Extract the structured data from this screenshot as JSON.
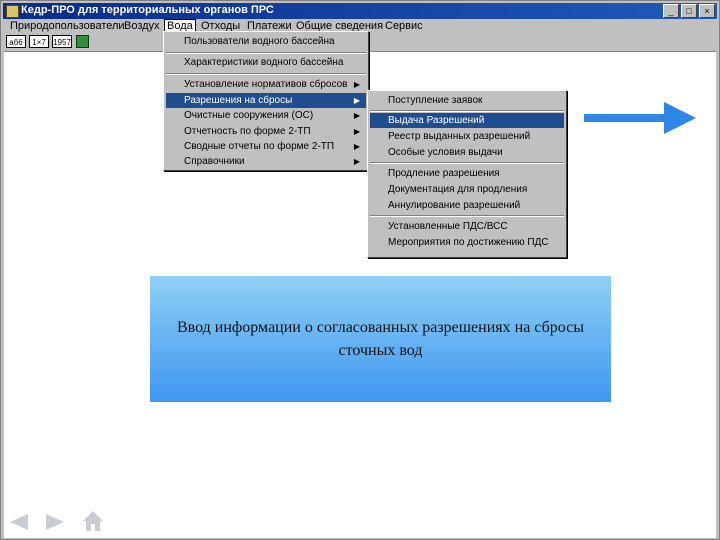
{
  "window": {
    "title": "Кедр-ПРО для территориальных органов ПРС",
    "buttons": [
      "_",
      "□",
      "×"
    ]
  },
  "menubar": {
    "items": [
      "Природопользователи",
      "Воздух",
      "Вода",
      "Отходы",
      "Платежи",
      "Общие сведения",
      "Сервис"
    ],
    "active_index": 2
  },
  "toolbar": {
    "buttons": [
      "аб6",
      "1×7",
      "1957",
      ""
    ]
  },
  "voda_menu": {
    "items": [
      {
        "label": "Пользователи водного бассейна",
        "submenu": false
      },
      {
        "label": "Характеристики водного бассейна",
        "submenu": false
      },
      {
        "label": "Установление нормативов сбросов",
        "submenu": true
      },
      {
        "label": "Разрешения на сбросы",
        "submenu": true,
        "highlighted": true
      },
      {
        "label": "Очистные сооружения (ОС)",
        "submenu": true
      },
      {
        "label": "Отчетность по форме 2-ТП",
        "submenu": true
      },
      {
        "label": "Сводные отчеты по форме 2-ТП",
        "submenu": true
      },
      {
        "label": "Справочники",
        "submenu": true
      }
    ]
  },
  "permits_menu": {
    "items": [
      {
        "label": "Поступление заявок"
      },
      {
        "label": "Выдача Разрешений",
        "highlighted": true
      },
      {
        "label": "Реестр выданных разрешений"
      },
      {
        "label": "Особые условия выдачи"
      },
      {
        "label": "Продление разрешения"
      },
      {
        "label": "Документация для продления"
      },
      {
        "label": "Аннулирование разрешений"
      },
      {
        "label": "Установленные ПДС/ВСС"
      },
      {
        "label": "Мероприятия по достижению ПДС"
      }
    ]
  },
  "callout": {
    "text": "Ввод информации о согласованных разрешениях на сбросы сточных вод"
  },
  "colors": {
    "titlebar": "#0a2a8a",
    "highlight": "#1f4d8f",
    "arrow": "#2e86e6",
    "callout_top": "#8fd0f5",
    "callout_bottom": "#3f96f0"
  }
}
